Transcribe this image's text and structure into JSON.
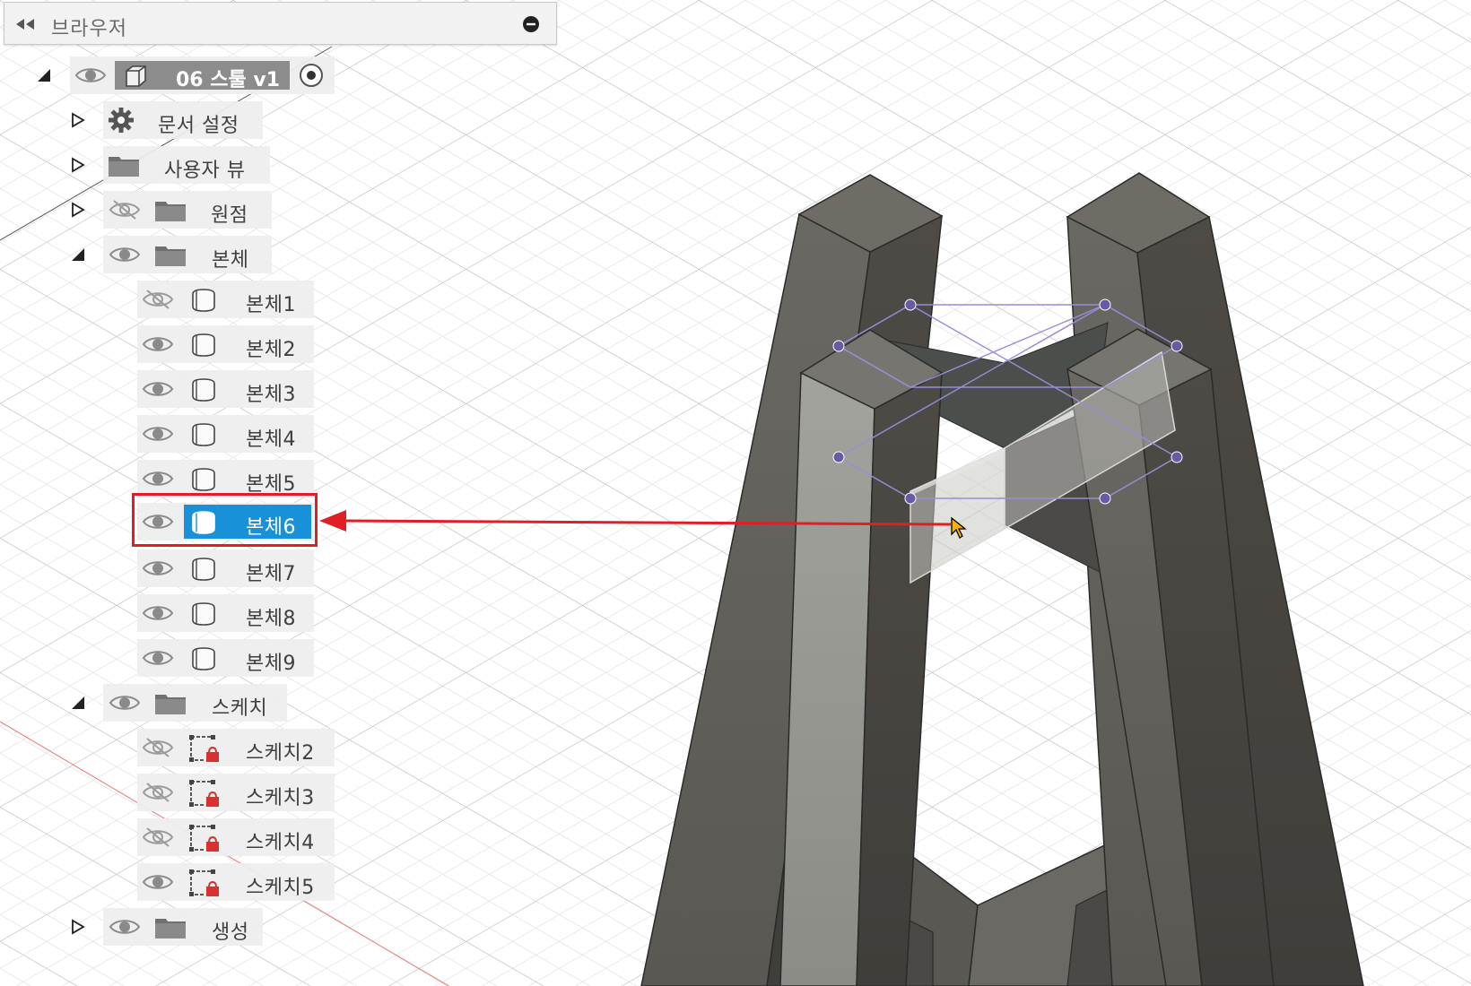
{
  "app": {
    "accent": "#1991d8",
    "annotation_color": "#e01e24"
  },
  "browser": {
    "title": "브라우저",
    "root": {
      "label": "06 스툴 v1"
    },
    "items": [
      {
        "label": "문서 설정"
      },
      {
        "label": "사용자 뷰"
      },
      {
        "label": "원점"
      },
      {
        "label": "본체"
      },
      {
        "label": "본체1"
      },
      {
        "label": "본체2"
      },
      {
        "label": "본체3"
      },
      {
        "label": "본체4"
      },
      {
        "label": "본체5"
      },
      {
        "label": "본체6"
      },
      {
        "label": "본체7"
      },
      {
        "label": "본체8"
      },
      {
        "label": "본체9"
      },
      {
        "label": "스케치"
      },
      {
        "label": "스케치2"
      },
      {
        "label": "스케치3"
      },
      {
        "label": "스케치4"
      },
      {
        "label": "스케치5"
      },
      {
        "label": "생성"
      }
    ]
  }
}
